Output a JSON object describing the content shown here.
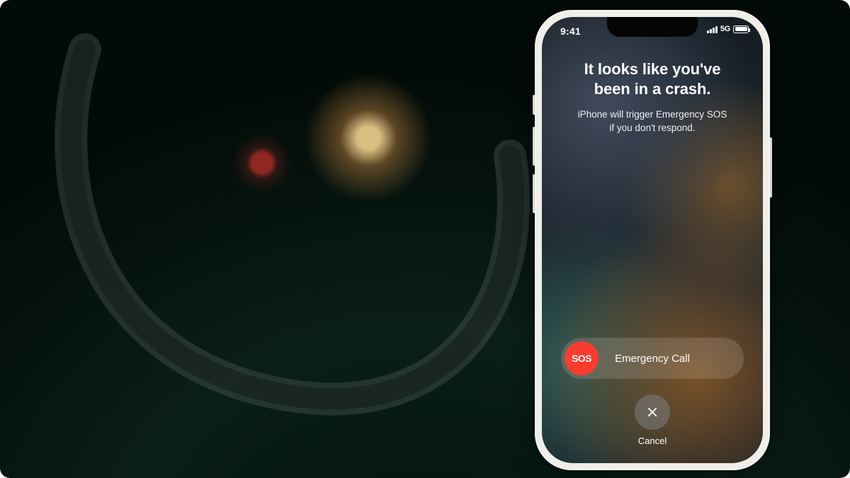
{
  "status": {
    "time": "9:41",
    "network": "5G"
  },
  "crash": {
    "headline_l1": "It looks like you've",
    "headline_l2": "been in a crash.",
    "subline_l1": "iPhone will trigger Emergency SOS",
    "subline_l2": "if you don't respond."
  },
  "sos": {
    "knob": "SOS",
    "label": "Emergency Call"
  },
  "cancel": {
    "label": "Cancel"
  },
  "colors": {
    "sos_red": "#ff3b30"
  }
}
